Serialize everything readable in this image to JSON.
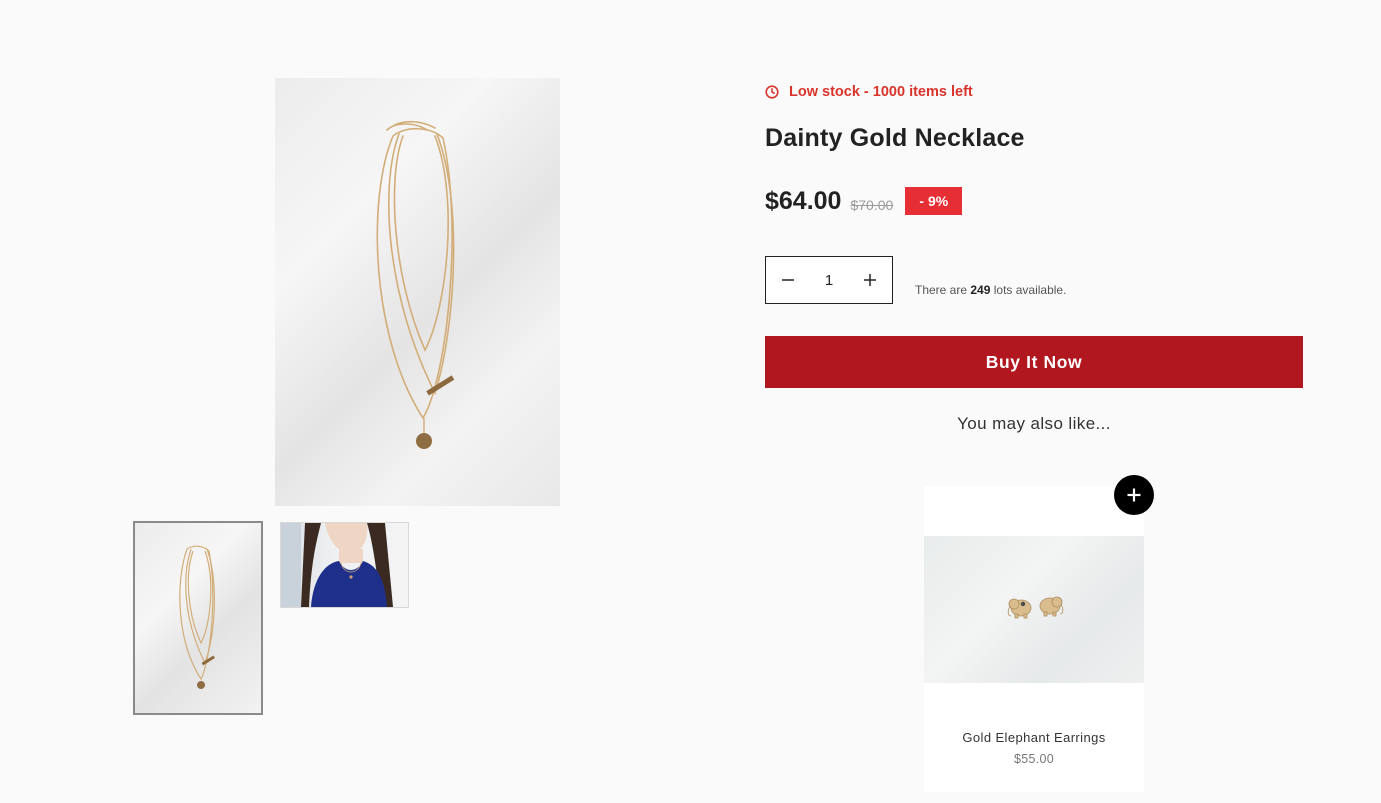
{
  "gallery": {
    "main_image": "necklace-flatlay",
    "thumbnails": [
      {
        "name": "necklace-flatlay",
        "selected": true
      },
      {
        "name": "necklace-worn-by-model",
        "selected": false
      }
    ]
  },
  "product": {
    "stock_icon": "clock-icon",
    "stock_text": "Low stock - 1000 items left",
    "title": "Dainty Gold Necklace",
    "price": "$64.00",
    "compare_price": "$70.00",
    "discount": "- 9%",
    "quantity": "1",
    "availability_prefix": "There are ",
    "availability_count": "249",
    "availability_suffix": " lots available.",
    "buy_label": "Buy It Now"
  },
  "recommendations": {
    "heading": "You may also like...",
    "items": [
      {
        "name": "Gold Elephant Earrings",
        "price": "$55.00",
        "image": "elephant-earrings"
      }
    ]
  },
  "colors": {
    "stock": "#d9342b",
    "discount_badge": "#e52f35",
    "buy_button": "#b0171f",
    "background": "#fafafa"
  }
}
